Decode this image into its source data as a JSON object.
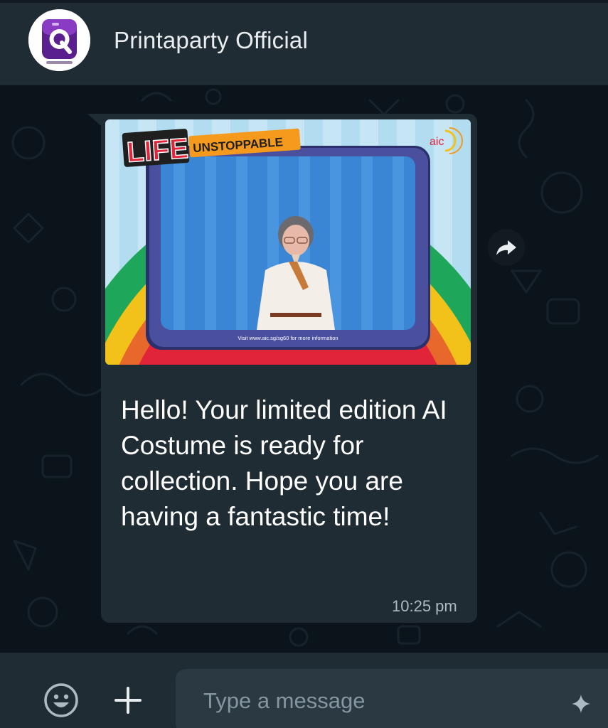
{
  "header": {
    "contact_name": "Printaparty Official"
  },
  "message": {
    "media": {
      "banner_life": "LIFE",
      "banner_unstoppable": "UNSTOPPABLE",
      "logo_text": "aic",
      "footer_text": "Visit www.aic.sg/sg60 for more information"
    },
    "text": "Hello! Your limited edition AI Costume is ready for collection. Hope you are having a fantastic time!",
    "time": "10:25 pm"
  },
  "composer": {
    "placeholder": "Type a message"
  },
  "icons": {
    "avatar": "printaparty-logo-icon",
    "forward": "forward-arrow-icon",
    "emoji": "emoji-smiley-icon",
    "attach": "plus-icon",
    "sparkle": "sparkle-icon"
  },
  "colors": {
    "header_bg": "#202c33",
    "chat_bg": "#0b141a",
    "bubble_bg": "#202c33",
    "input_bg": "#2a3942",
    "frame_purple": "#4a4f9e",
    "photo_blue": "#3a86d4",
    "rainbow_green": "#1ea65a",
    "rainbow_yellow": "#f2c21b",
    "rainbow_red": "#e2243a",
    "banner_orange": "#f59a1c"
  }
}
